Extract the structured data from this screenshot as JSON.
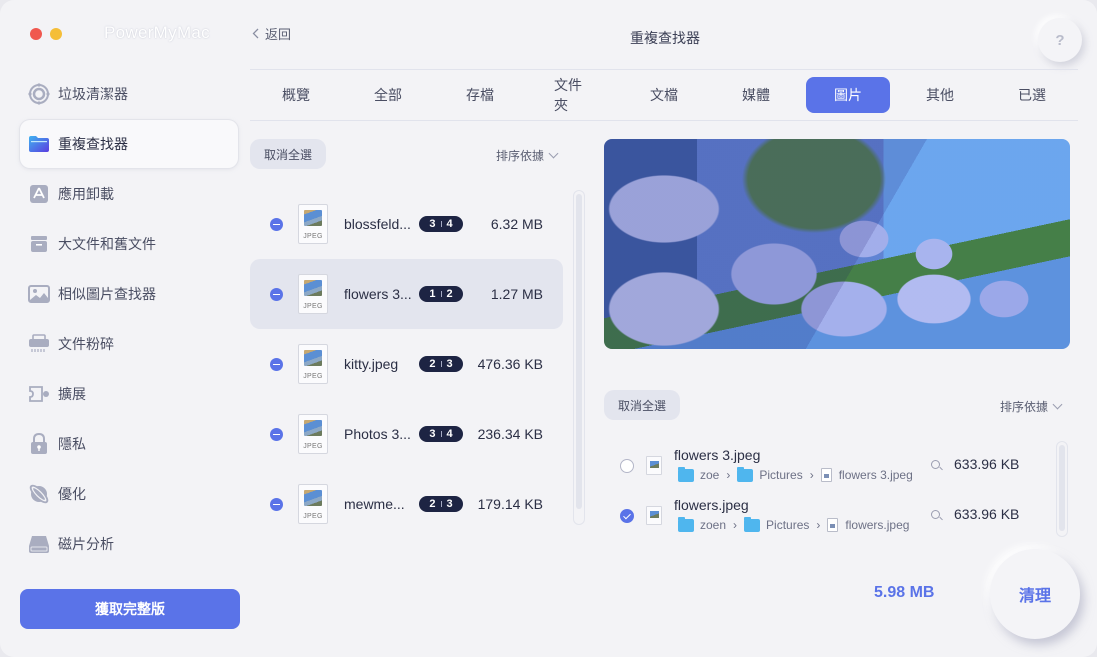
{
  "window": {
    "app_title": "PowerMyMac",
    "page_title": "重複查找器",
    "back_label": "返回",
    "help_label": "?"
  },
  "sidebar": {
    "items": [
      {
        "label": "垃圾清潔器",
        "icon": "junk-cleaner-icon"
      },
      {
        "label": "重複查找器",
        "icon": "folder-icon",
        "active": true
      },
      {
        "label": "應用卸載",
        "icon": "app-uninstaller-icon"
      },
      {
        "label": "大文件和舊文件",
        "icon": "large-files-icon"
      },
      {
        "label": "相似圖片查找器",
        "icon": "image-icon"
      },
      {
        "label": "文件粉碎",
        "icon": "shredder-icon"
      },
      {
        "label": "擴展",
        "icon": "extension-icon"
      },
      {
        "label": "隱私",
        "icon": "lock-icon"
      },
      {
        "label": "優化",
        "icon": "optimize-icon"
      },
      {
        "label": "磁片分析",
        "icon": "disk-icon"
      }
    ],
    "upgrade_label": "獲取完整版"
  },
  "tabs": [
    {
      "label": "概覽"
    },
    {
      "label": "全部"
    },
    {
      "label": "存檔"
    },
    {
      "label": "文件夾"
    },
    {
      "label": "文檔"
    },
    {
      "label": "媒體"
    },
    {
      "label": "圖片",
      "active": true
    },
    {
      "label": "其他"
    },
    {
      "label": "已選"
    }
  ],
  "left_panel": {
    "deselect_label": "取消全選",
    "sort_label": "排序依據",
    "groups": [
      {
        "name": "blossfeld...",
        "icon_text": "JPEG",
        "badge_a": "3",
        "badge_b": "4",
        "size": "6.32 MB"
      },
      {
        "name": "flowers 3...",
        "icon_text": "JPEG",
        "badge_a": "1",
        "badge_b": "2",
        "size": "1.27 MB",
        "selected": true
      },
      {
        "name": "kitty.jpeg",
        "icon_text": "JPEG",
        "badge_a": "2",
        "badge_b": "3",
        "size": "476.36 KB"
      },
      {
        "name": "Photos 3...",
        "icon_text": "JPEG",
        "badge_a": "3",
        "badge_b": "4",
        "size": "236.34 KB"
      },
      {
        "name": "mewme...",
        "icon_text": "JPEG",
        "badge_a": "2",
        "badge_b": "3",
        "size": "179.14 KB"
      }
    ]
  },
  "right_panel": {
    "deselect_label": "取消全選",
    "sort_label": "排序依據",
    "files": [
      {
        "name": "flowers 3.jpeg",
        "path": [
          "zoe",
          "Pictures",
          "flowers 3.jpeg"
        ],
        "size": "633.96 KB",
        "checked": false
      },
      {
        "name": "flowers.jpeg",
        "path": [
          "zoen",
          "Pictures",
          "flowers.jpeg"
        ],
        "size": "633.96 KB",
        "checked": true
      }
    ]
  },
  "footer": {
    "total_size": "5.98 MB",
    "clean_label": "清理"
  },
  "colors": {
    "accent": "#5a73e8",
    "badge_bg": "#1d2443",
    "background": "#f3f3f6"
  }
}
